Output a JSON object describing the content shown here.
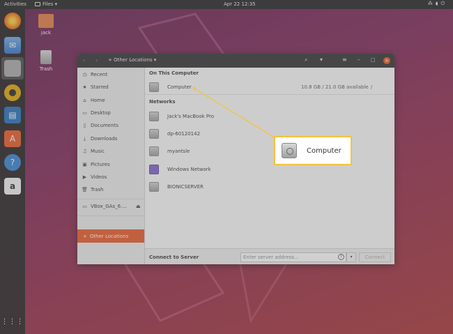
{
  "topbar": {
    "activities": "Activities",
    "app_menu": "Files ▾",
    "clock": "Apr 22  12:35",
    "tray_icons": [
      "network-icon",
      "volume-icon",
      "power-icon"
    ]
  },
  "desktop": {
    "icons": [
      {
        "label": "jack",
        "icon": "home-folder-icon"
      },
      {
        "label": "Trash",
        "icon": "trash-icon"
      }
    ]
  },
  "dock": {
    "apps": [
      "firefox-icon",
      "thunderbird-icon",
      "files-icon",
      "rhythmbox-icon",
      "writer-icon",
      "software-icon",
      "help-icon",
      "amazon-icon"
    ],
    "amazon_glyph": "a",
    "help_glyph": "?"
  },
  "window": {
    "location": "Other Locations",
    "header_add": "+",
    "header_menu_caret": "▾",
    "sidebar": {
      "items": [
        {
          "label": "Recent",
          "icon": "clock-icon"
        },
        {
          "label": "Starred",
          "icon": "star-icon"
        },
        {
          "label": "Home",
          "icon": "home-icon"
        },
        {
          "label": "Desktop",
          "icon": "desktop-icon"
        },
        {
          "label": "Documents",
          "icon": "documents-icon"
        },
        {
          "label": "Downloads",
          "icon": "downloads-icon"
        },
        {
          "label": "Music",
          "icon": "music-icon"
        },
        {
          "label": "Pictures",
          "icon": "pictures-icon"
        },
        {
          "label": "Videos",
          "icon": "videos-icon"
        },
        {
          "label": "Trash",
          "icon": "trash-icon"
        }
      ],
      "mounted": {
        "label": "VBox_GAs_6....",
        "eject": "⏏"
      },
      "other_locations": "Other Locations"
    },
    "main": {
      "on_this_computer": "On This Computer",
      "computer": {
        "name": "Computer",
        "usage": "10.8 GB / 21.0 GB available",
        "mount": "/"
      },
      "networks": "Networks",
      "network_items": [
        "Jack's MacBook Pro",
        "dp-60120142",
        "myantsle",
        "Windows Network",
        "BIONICSERVER"
      ]
    },
    "footer": {
      "label": "Connect to Server",
      "server_placeholder": "Enter server address...",
      "help_glyph": "?",
      "dropdown_glyph": "▾",
      "connect": "Connect"
    }
  },
  "callout": {
    "label": "Computer",
    "highlight_color": "#f6c23e"
  },
  "colors": {
    "accent": "#e95420",
    "topbar": "#1d1d1d",
    "header": "#2c2c2c"
  }
}
